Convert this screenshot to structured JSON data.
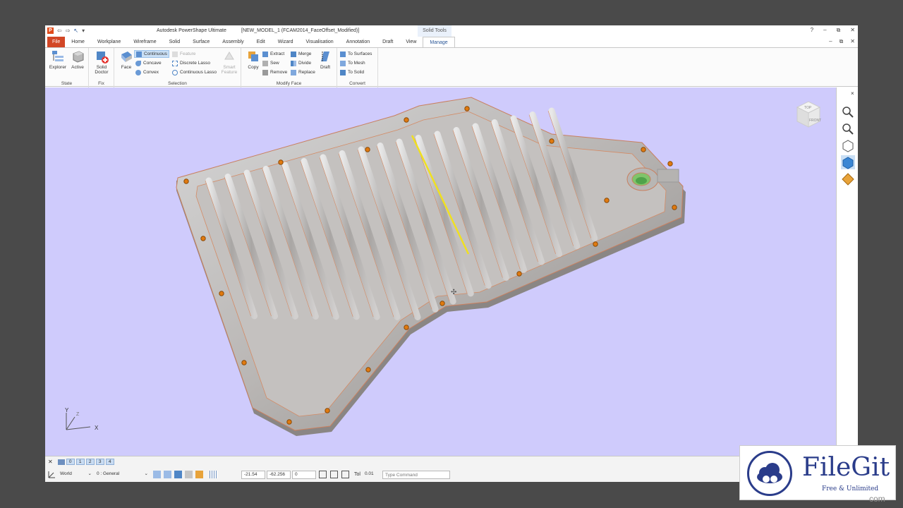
{
  "titlebar": {
    "app_title": "Autodesk PowerShape Ultimate",
    "doc_title": "[NEW_MODEL_1 (FCAM2014_FaceOffset_Modified)]",
    "context_tab": "Solid Tools",
    "help": "?",
    "minimize": "–",
    "restore": "⧉",
    "close": "✕",
    "quick_access": [
      "⇦",
      "⇨",
      "↖",
      "▾"
    ]
  },
  "tabs": [
    {
      "label": "File"
    },
    {
      "label": "Home"
    },
    {
      "label": "Workplane"
    },
    {
      "label": "Wireframe"
    },
    {
      "label": "Solid"
    },
    {
      "label": "Surface"
    },
    {
      "label": "Assembly"
    },
    {
      "label": "Edit"
    },
    {
      "label": "Wizard"
    },
    {
      "label": "Visualisation"
    },
    {
      "label": "Annotation"
    },
    {
      "label": "Draft"
    },
    {
      "label": "View"
    },
    {
      "label": "Manage"
    }
  ],
  "ribbon": {
    "state": {
      "label": "State",
      "explorer": "Explorer",
      "active": "Active"
    },
    "fix": {
      "label": "Fix",
      "solid_doctor": "Solid",
      "solid_doctor_2": "Doctor"
    },
    "selection": {
      "label": "Selection",
      "face": "Face",
      "continuous": "Continuous",
      "concave": "Concave",
      "convex": "Convex",
      "feature": "Feature",
      "discrete_lasso": "Discrete Lasso",
      "continuous_lasso": "Continuous Lasso",
      "smart_feature": "Smart",
      "smart_feature_2": "Feature"
    },
    "modify_face": {
      "label": "Modify Face",
      "copy": "Copy",
      "extract": "Extract",
      "sew": "Sew",
      "remove": "Remove",
      "merge": "Merge",
      "divide": "Divide",
      "replace": "Replace",
      "draft": "Draft"
    },
    "convert": {
      "label": "Convert",
      "to_surfaces": "To Surfaces",
      "to_mesh": "To Mesh",
      "to_solid": "To Solid"
    }
  },
  "viewport": {
    "viewcube_top": "TOP",
    "viewcube_front": "FRONT",
    "axis_x": "X",
    "axis_y": "Y",
    "axis_z": "Z",
    "background": "#cfcbfc"
  },
  "rightbar": {
    "close": "×"
  },
  "statusbar": {
    "close": "✕",
    "view_tabs": [
      "0",
      "1",
      "2",
      "3",
      "4"
    ],
    "workplane": "World",
    "level": "0 : General",
    "coord_x": "-21.54",
    "coord_y": "-62.256",
    "coord_z": "0",
    "tol_label": "Tol",
    "tol_value": "0.01",
    "command_placeholder": "Type Command"
  },
  "watermark": {
    "brand": "FileGit",
    "tagline": "Free & Unlimited",
    "corner": "com"
  },
  "colors": {
    "accent": "#2b5797",
    "file_tab": "#d24726",
    "viewport_bg": "#cfcbfc",
    "selected_face_edge": "#f0e020"
  }
}
